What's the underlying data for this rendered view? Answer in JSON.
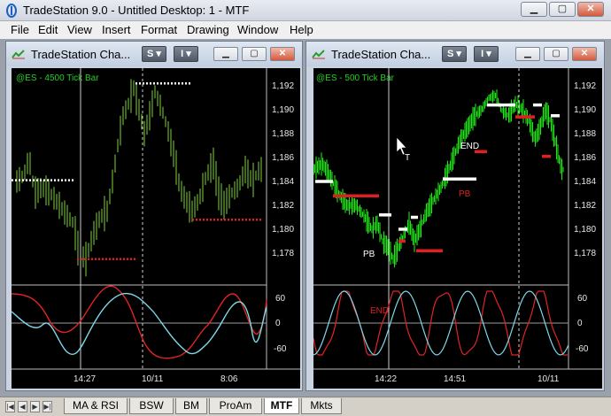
{
  "app": {
    "title": "TradeStation 9.0 - Untitled Desktop: 1 - MTF"
  },
  "menu": [
    "File",
    "Edit",
    "View",
    "Insert",
    "Format",
    "Drawing",
    "Window",
    "Help"
  ],
  "windows": [
    {
      "title": "TradeStation Cha...",
      "symbol_label": "@ES - 4500 Tick Bar",
      "s_button": "S",
      "i_button": "I",
      "price_ticks": [
        "1,192",
        "1,190",
        "1,188",
        "1,186",
        "1,184",
        "1,182",
        "1,180",
        "1,178"
      ],
      "osc_ticks": [
        "60",
        "0",
        "-60"
      ],
      "time_ticks": [
        "14:27",
        "10/11",
        "8:06"
      ]
    },
    {
      "title": "TradeStation Cha...",
      "symbol_label": "@ES - 500 Tick Bar",
      "s_button": "S",
      "i_button": "I",
      "price_ticks": [
        "1,192",
        "1,190",
        "1,188",
        "1,186",
        "1,184",
        "1,182",
        "1,180",
        "1,178"
      ],
      "osc_ticks": [
        "60",
        "0",
        "-60"
      ],
      "time_ticks": [
        "14:22",
        "14:51",
        "10/11"
      ],
      "annotations": [
        "END",
        "PB",
        "PB",
        "END"
      ]
    }
  ],
  "tabs": [
    "MA & RSI",
    "BSW",
    "BM",
    "ProAm",
    "MTF",
    "Mkts"
  ],
  "active_tab": "MTF",
  "colors": {
    "bars_left": "#7fd23a",
    "bars_right": "#22e01a",
    "osc_red": "#e02424",
    "osc_cyan": "#7fd8e8",
    "level_white": "#ffffff",
    "level_red": "#e02020"
  }
}
